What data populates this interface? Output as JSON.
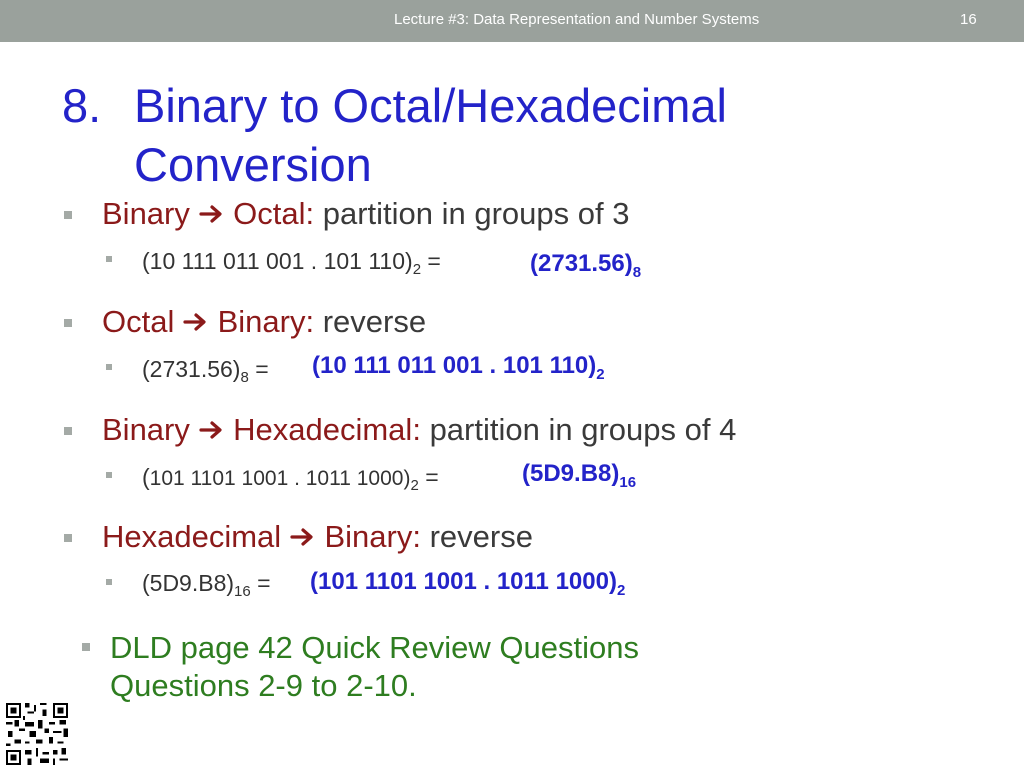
{
  "header": {
    "title": "Lecture #3: Data Representation and Number Systems",
    "page_number": "16"
  },
  "slide": {
    "number": "8.",
    "title_line1": "Binary to Octal/Hexadecimal",
    "title_line2": "Conversion"
  },
  "sections": [
    {
      "from": "Binary",
      "to": "Octal:",
      "rest": "partition in groups of 3",
      "example": "(10 111 011 001 . 101 110)",
      "example_base": "2",
      "equals": "=",
      "answer": "(2731.56)",
      "answer_base": "8"
    },
    {
      "from": "Octal",
      "to": "Binary:",
      "rest": "reverse",
      "example": "(2731.56)",
      "example_base": "8",
      "equals": "=",
      "answer": "(10 111 011 001 . 101 110)",
      "answer_base": "2"
    },
    {
      "from": "Binary",
      "to": "Hexadecimal:",
      "rest": "partition in groups of 4",
      "example_open": "(",
      "example": "101 1101 1001 . 1011 1000)",
      "example_base": "2",
      "equals": "=",
      "answer": "(5D9.B8)",
      "answer_base": "16"
    },
    {
      "from": "Hexadecimal",
      "to": "Binary:",
      "rest": "reverse",
      "example": "(5D9.B8)",
      "example_base": "16",
      "equals": "=",
      "answer": "(101 1101 1001 . 1011 1000)",
      "answer_base": "2"
    }
  ],
  "review": {
    "line1": "DLD page 42 Quick Review Questions",
    "line2": "Questions 2-9 to 2-10."
  },
  "colors": {
    "header_bg": "#9aa19c",
    "title": "#2323c9",
    "term": "#8b1a1a",
    "answer": "#2323c9",
    "review": "#2e7d20"
  },
  "icons": {
    "arrow": "right-arrow-icon",
    "qr": "qr-code-icon"
  }
}
